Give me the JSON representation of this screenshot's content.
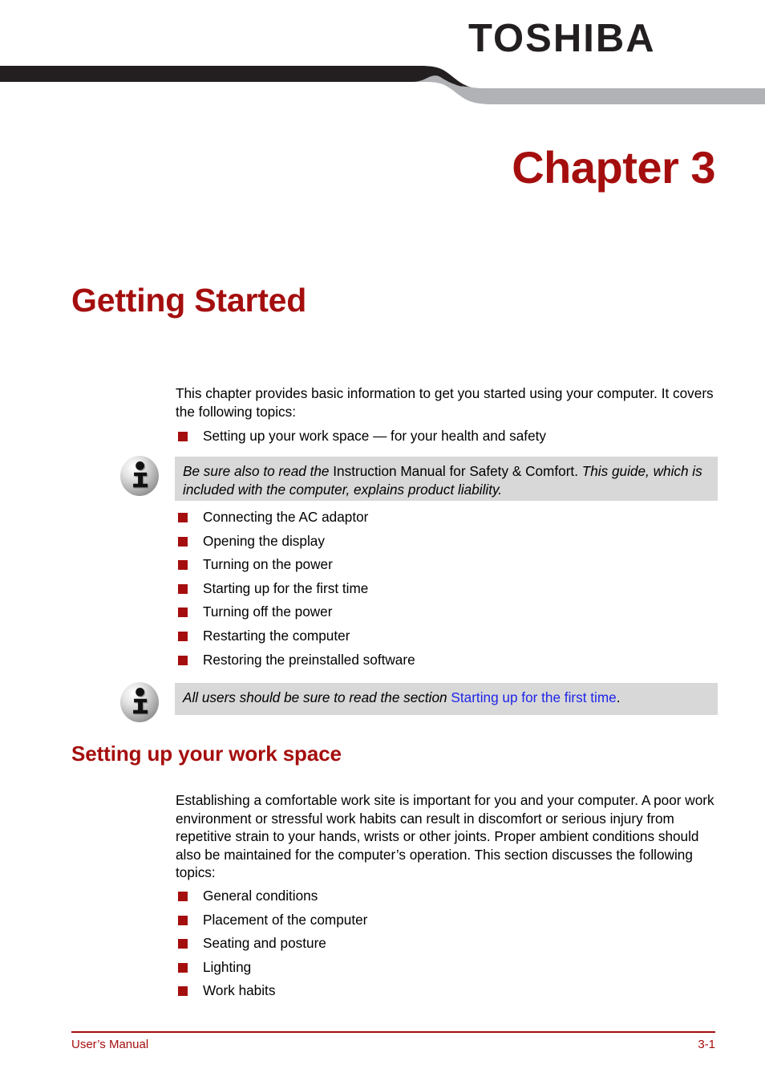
{
  "brand": "TOSHIBA",
  "chapter": {
    "title": "Chapter 3",
    "doc_title": "Getting Started"
  },
  "colors": {
    "accent_red": "#a50e0e",
    "bullet_red": "#a50e0e",
    "banner_black": "#231f20",
    "banner_gray": "#b0b2b5",
    "notice_bg": "#d8d8d8",
    "link_blue": "#1f25e8"
  },
  "intro": {
    "paragraph": "This chapter provides basic information to get you started using your computer. It covers the following topics:",
    "topics_first": [
      "Setting up your work space — for your health and safety"
    ],
    "topics_rest": [
      "Connecting the AC adaptor",
      "Opening the display",
      "Turning on the power",
      "Starting up for the first time",
      "Turning off the power",
      "Restarting the computer",
      "Restoring the preinstalled software"
    ]
  },
  "notices": [
    {
      "icon": "info-icon",
      "part1": "Be sure also to read the ",
      "part2": "Instruction Manual for Safety & Comfort.",
      "part3": " This guide, which is included with the computer, explains product liability.",
      "link": "",
      "tail": ""
    },
    {
      "icon": "info-icon",
      "part1": "All users should be sure to read the section ",
      "part2": "",
      "part3": "",
      "link": "Starting up for the first time",
      "tail": "."
    }
  ],
  "workspace": {
    "heading": "Setting up your work space",
    "paragraph": "Establishing a comfortable work site is important for you and your computer. A poor work environment or stressful work habits can result in discomfort or serious injury from repetitive strain to your hands, wrists or other joints. Proper ambient conditions should also be maintained for the computer’s operation. This section discusses the following topics:",
    "topics": [
      "General conditions",
      "Placement of the computer",
      "Seating and posture",
      "Lighting",
      "Work habits"
    ]
  },
  "footer": {
    "left": "User’s Manual",
    "right": "3-1"
  }
}
